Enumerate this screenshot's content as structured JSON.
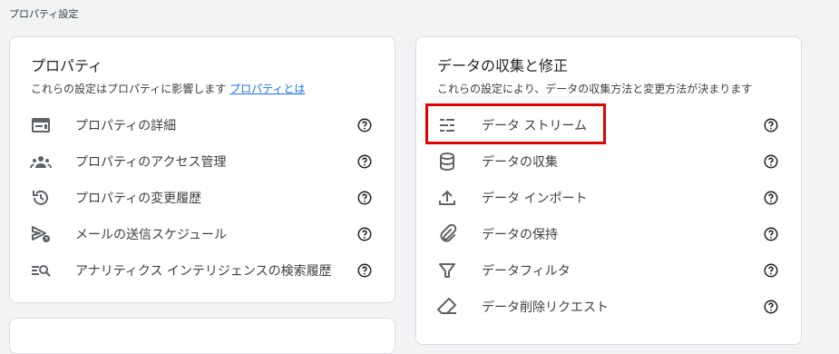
{
  "page": {
    "title": "プロパティ設定"
  },
  "property_card": {
    "title": "プロパティ",
    "desc": "これらの設定はプロパティに影響します",
    "desc_link": "プロパティとは",
    "items": [
      {
        "label": "プロパティの詳細",
        "icon": "property-details-icon"
      },
      {
        "label": "プロパティのアクセス管理",
        "icon": "people-icon"
      },
      {
        "label": "プロパティの変更履歴",
        "icon": "history-icon"
      },
      {
        "label": "メールの送信スケジュール",
        "icon": "send-schedule-icon"
      },
      {
        "label": "アナリティクス インテリジェンスの検索履歴",
        "icon": "search-history-icon"
      }
    ]
  },
  "data_card": {
    "title": "データの収集と修正",
    "desc": "これらの設定により、データの収集方法と変更方法が決まります",
    "items": [
      {
        "label": "データ ストリーム",
        "icon": "data-stream-icon",
        "highlighted": true
      },
      {
        "label": "データの収集",
        "icon": "database-icon"
      },
      {
        "label": "データ インポート",
        "icon": "upload-icon"
      },
      {
        "label": "データの保持",
        "icon": "attachment-icon"
      },
      {
        "label": "データフィルタ",
        "icon": "filter-icon"
      },
      {
        "label": "データ削除リクエスト",
        "icon": "eraser-icon"
      }
    ]
  },
  "colors": {
    "highlight": "#e00000",
    "link": "#1a73e8",
    "icon": "#5f6368"
  }
}
